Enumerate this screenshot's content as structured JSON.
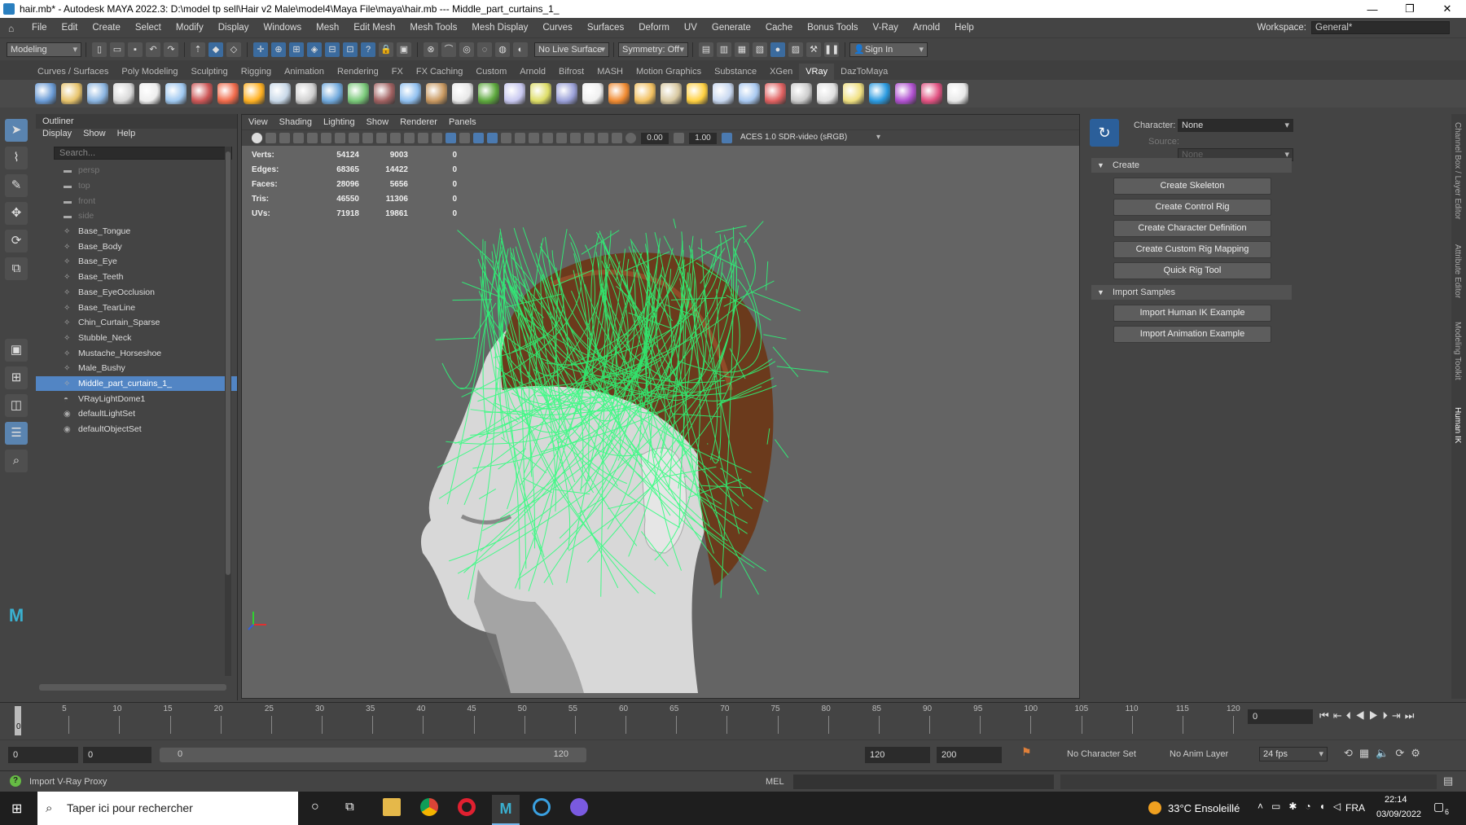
{
  "window": {
    "title": "hair.mb* - Autodesk MAYA 2022.3: D:\\model tp sell\\Hair v2 Male\\model4\\Maya File\\maya\\hair.mb   ---   Middle_part_curtains_1_",
    "minimize": "—",
    "maximize": "❐",
    "close": "✕"
  },
  "menubar": {
    "items": [
      "File",
      "Edit",
      "Create",
      "Select",
      "Modify",
      "Display",
      "Windows",
      "Mesh",
      "Edit Mesh",
      "Mesh Tools",
      "Mesh Display",
      "Curves",
      "Surfaces",
      "Deform",
      "UV",
      "Generate",
      "Cache",
      "Bonus Tools",
      "V-Ray",
      "Arnold",
      "Help"
    ],
    "workspace_label": "Workspace:",
    "workspace_value": "General*"
  },
  "statusline": {
    "mode": "Modeling",
    "live_surface": "No Live Surface",
    "symmetry": "Symmetry: Off",
    "sign_in": "Sign In"
  },
  "shelf": {
    "tabs": [
      "Curves / Surfaces",
      "Poly Modeling",
      "Sculpting",
      "Rigging",
      "Animation",
      "Rendering",
      "FX",
      "FX Caching",
      "Custom",
      "Arnold",
      "Bifrost",
      "MASH",
      "Motion Graphics",
      "Substance",
      "XGen",
      "VRay",
      "DazToMaya"
    ],
    "active_tab": "VRay",
    "icon_colors": [
      "#6a9bd6",
      "#e7c36b",
      "#8ab4e0",
      "#d8d8d8",
      "#eeeeee",
      "#9fc8f0",
      "#cc5555",
      "#f06a4a",
      "#ffb020",
      "#c8d8e8",
      "#d0d0d0",
      "#6fa8dc",
      "#78c878",
      "#a06060",
      "#8fbfef",
      "#c89860",
      "#e8e8e8",
      "#5ca83c",
      "#c8c8f0",
      "#dddd66",
      "#9aa0d8",
      "#f0f0f0",
      "#f08a30",
      "#f2c060",
      "#d8c8a0",
      "#ffd040",
      "#c8d8f0",
      "#a8c8f0",
      "#e06060",
      "#cccccc",
      "#e0e0e0",
      "#f0e080",
      "#2a9ae0",
      "#b050d0",
      "#e05080",
      "#e8e8e8"
    ]
  },
  "outliner": {
    "title": "Outliner",
    "menu": [
      "Display",
      "Show",
      "Help"
    ],
    "search_placeholder": "Search...",
    "items": [
      {
        "label": "persp",
        "dim": true
      },
      {
        "label": "top",
        "dim": true
      },
      {
        "label": "front",
        "dim": true
      },
      {
        "label": "side",
        "dim": true
      },
      {
        "label": "Base_Tongue"
      },
      {
        "label": "Base_Body"
      },
      {
        "label": "Base_Eye"
      },
      {
        "label": "Base_Teeth"
      },
      {
        "label": "Base_EyeOcclusion"
      },
      {
        "label": "Base_TearLine"
      },
      {
        "label": "Chin_Curtain_Sparse"
      },
      {
        "label": "Stubble_Neck"
      },
      {
        "label": "Mustache_Horseshoe"
      },
      {
        "label": "Male_Bushy"
      },
      {
        "label": "Middle_part_curtains_1_",
        "selected": true
      },
      {
        "label": "VRayLightDome1"
      },
      {
        "label": "defaultLightSet"
      },
      {
        "label": "defaultObjectSet"
      }
    ]
  },
  "viewport": {
    "menu": [
      "View",
      "Shading",
      "Lighting",
      "Show",
      "Renderer",
      "Panels"
    ],
    "exposure": "0.00",
    "gamma": "1.00",
    "color_space": "ACES 1.0 SDR-video (sRGB)",
    "hud": [
      {
        "label": "Verts:",
        "a": "54124",
        "b": "9003",
        "c": "0"
      },
      {
        "label": "Edges:",
        "a": "68365",
        "b": "14422",
        "c": "0"
      },
      {
        "label": "Faces:",
        "a": "28096",
        "b": "5656",
        "c": "0"
      },
      {
        "label": "Tris:",
        "a": "46550",
        "b": "11306",
        "c": "0"
      },
      {
        "label": "UVs:",
        "a": "71918",
        "b": "19861",
        "c": "0"
      }
    ]
  },
  "humanik": {
    "character_label": "Character:",
    "character_value": "None",
    "source_label": "Source:",
    "source_value": "None",
    "create_header": "Create",
    "create_buttons": [
      "Create Skeleton",
      "Create Control Rig",
      "Create Character Definition",
      "Create Custom Rig Mapping",
      "Quick Rig Tool"
    ],
    "import_header": "Import Samples",
    "import_buttons": [
      "Import Human IK Example",
      "Import Animation Example"
    ]
  },
  "side_tabs": [
    "Channel Box / Layer Editor",
    "Attribute Editor",
    "Modeling Toolkit",
    "Human IK"
  ],
  "timeline": {
    "ticks": [
      "0",
      "5",
      "10",
      "15",
      "20",
      "25",
      "30",
      "35",
      "40",
      "45",
      "50",
      "55",
      "60",
      "65",
      "70",
      "75",
      "80",
      "85",
      "90",
      "95",
      "100",
      "105",
      "110",
      "115",
      "120"
    ],
    "current_frame": "0"
  },
  "range": {
    "start": "0",
    "inner_start": "0",
    "slider_start": "0",
    "slider_end": "120",
    "end": "120",
    "outer_end": "200",
    "character_set": "No Character Set",
    "anim_layer": "No Anim Layer",
    "fps": "24 fps"
  },
  "cmdline": {
    "help_text": "Import V-Ray Proxy",
    "lang": "MEL"
  },
  "taskbar": {
    "search_placeholder": "Taper ici pour rechercher",
    "weather": "33°C  Ensoleillé",
    "lang": "FRA",
    "time": "22:14",
    "date": "03/09/2022",
    "notifications": "6"
  }
}
